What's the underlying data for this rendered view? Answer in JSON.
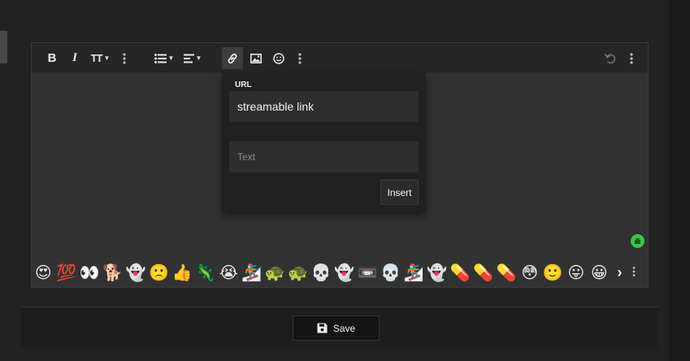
{
  "toolbar": {
    "buttons": {
      "bold": "B",
      "italic": "I",
      "text_size": "TT"
    }
  },
  "link_popup": {
    "url_label": "URL",
    "url_value": "streamable link",
    "text_placeholder": "Text",
    "insert_label": "Insert"
  },
  "emoji_bar": {
    "emojis": [
      "😍",
      "💯",
      "👀",
      "🐕",
      "👻",
      "🙁",
      "👍",
      "🦎",
      "😭",
      "🏂",
      "🐢",
      "🐢",
      "💀",
      "👻",
      "📼",
      "💀",
      "🏂",
      "👻",
      "💊",
      "💊",
      "💊",
      "😳",
      "🙂",
      "😛",
      "😀"
    ]
  },
  "footer": {
    "save_label": "Save"
  },
  "colors": {
    "page_bg": "#222222",
    "editor_bg": "#323232",
    "toolbar_bg": "#262626",
    "popup_bg": "#212121",
    "status_green": "#3cc44a"
  }
}
